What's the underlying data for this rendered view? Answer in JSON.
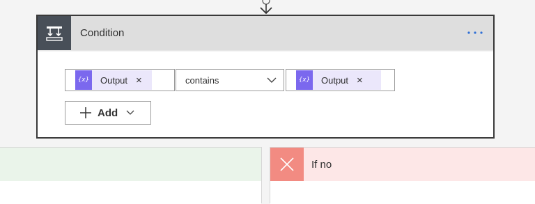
{
  "condition": {
    "title": "Condition",
    "left_operand": {
      "token_label": "Output",
      "token_icon": "{x}",
      "remove": "×"
    },
    "operator": {
      "selected": "contains"
    },
    "right_operand": {
      "token_label": "Output",
      "token_icon": "{x}",
      "remove": "×"
    },
    "add_button": {
      "label": "Add"
    }
  },
  "branches": {
    "no": {
      "title": "If no"
    }
  },
  "colors": {
    "header_bg": "#dedede",
    "header_icon_bg": "#484f58",
    "token_bg": "#ebe7fb",
    "token_icon_bg": "#7b68ee",
    "yes_header_bg": "#eaf4ea",
    "no_header_bg": "#fde7e7",
    "no_icon_bg": "#f28b82",
    "ellipsis": "#2f6fd6"
  },
  "icons": {
    "connector": "arrow-down-icon",
    "condition": "condition-icon",
    "more": "ellipsis-icon",
    "expression": "expression-icon",
    "remove": "close-icon",
    "dropdown": "chevron-down-icon",
    "add": "plus-icon",
    "branch_no": "close-icon"
  }
}
